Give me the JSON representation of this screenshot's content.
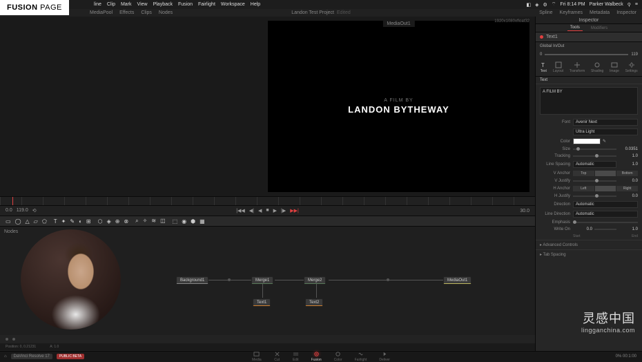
{
  "badge": {
    "text1": "FUSION ",
    "text2": "PAGE"
  },
  "menubar": {
    "items": [
      "line",
      "Clip",
      "Mark",
      "View",
      "Playback",
      "Fusion",
      "Fairlight",
      "Workspace",
      "Help"
    ],
    "right": {
      "time": "Fri 8:14 PM",
      "user": "Parker Walbeck"
    }
  },
  "app_header": {
    "left": [
      "MediaPool",
      "Effects",
      "Clips",
      "Nodes"
    ],
    "center": "Landon Test Project",
    "suffix": "Edited",
    "right": [
      "Spline",
      "Keyframes",
      "Metadata",
      "Inspector"
    ]
  },
  "inspector": {
    "title": "Inspector",
    "tabs": [
      "Tools",
      "Modifiers"
    ],
    "node_name": "Text1",
    "global_label": "Global In/Out",
    "global_in": "0",
    "global_out": "119",
    "mode_tabs": [
      "Text",
      "Layout",
      "Transform",
      "Shading",
      "Image",
      "Settings"
    ],
    "sub_tabs": [
      "Text"
    ],
    "textarea": "A FILM BY",
    "rows": {
      "font_label": "Font",
      "font_value": "Avenir Next",
      "font_weight": "Ultra Light",
      "color_label": "Color",
      "size_label": "Size",
      "size_value": "0.0351",
      "tracking_label": "Tracking",
      "tracking_value": "1.0",
      "line_spacing_label": "Line Spacing",
      "line_spacing_value": "Automatic",
      "line_spacing_num": "1.0",
      "v_anchor_label": "V Anchor",
      "v_anchor_opts": [
        "Top",
        "",
        "Bottom"
      ],
      "v_justify_label": "V Justify",
      "v_justify_value": "0.0",
      "h_anchor_label": "H Anchor",
      "h_anchor_opts": [
        "Left",
        "",
        "Right"
      ],
      "h_justify_label": "H Justify",
      "h_justify_value": "0.0",
      "direction_label": "Direction",
      "direction_value": "Automatic",
      "line_dir_label": "Line Direction",
      "line_dir_value": "Automatic",
      "emphasis_label": "Emphasis",
      "write_on_label": "Write On",
      "write_on_start": "0.0",
      "write_on_end": "1.0",
      "write_on_start_lbl": "Start",
      "write_on_end_lbl": "End"
    },
    "collapse1": "Advanced Controls",
    "collapse2": "Tab Spacing"
  },
  "viewer": {
    "label": "MediaOut1",
    "resolution": "1920x1080xfloat32",
    "subtitle": "A FILM BY",
    "title": "LANDON BYTHEWAY"
  },
  "transport": {
    "in": "0.0",
    "out": "119.0",
    "end": "30.0"
  },
  "nodes": {
    "label": "Nodes",
    "background": "Background1",
    "merge1": "Merge1",
    "merge2": "Merge2",
    "text1": "Text1",
    "text2": "Text2",
    "mediaout": "MediaOut1"
  },
  "status": {
    "pos": "Position: 0, 0.21231",
    "color": "",
    "alpha": "A: 1.0"
  },
  "bottom": {
    "app": "DaVinci Resolve 17",
    "beta": "PUBLIC BETA",
    "pages": [
      "Media",
      "Cut",
      "Edit",
      "Fusion",
      "Color",
      "Fairlight",
      "Deliver"
    ],
    "right": "0%   00:1:00"
  },
  "watermark": {
    "cn": "灵感中国",
    "en": "lingganchina.com"
  }
}
